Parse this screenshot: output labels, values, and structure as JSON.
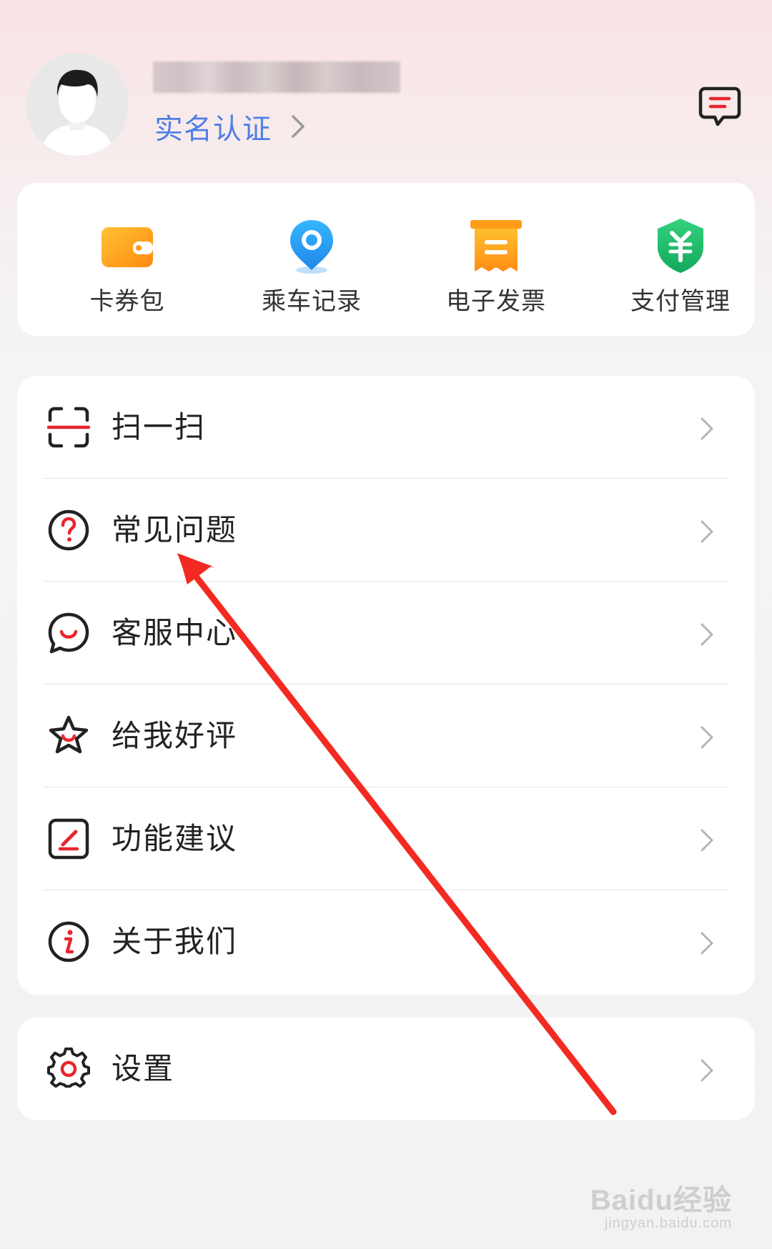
{
  "header": {
    "realname_label": "实名认证"
  },
  "quick_actions": [
    {
      "label": "卡券包",
      "icon": "wallet-icon",
      "color": "#ff9a1f"
    },
    {
      "label": "乘车记录",
      "icon": "location-pin-icon",
      "color": "#2ea0f5"
    },
    {
      "label": "电子发票",
      "icon": "invoice-icon",
      "color": "#ffa31a"
    },
    {
      "label": "支付管理",
      "icon": "yuan-shield-icon",
      "color": "#1fc26b"
    }
  ],
  "menu": [
    {
      "label": "扫一扫",
      "icon": "scan-icon"
    },
    {
      "label": "常见问题",
      "icon": "question-icon"
    },
    {
      "label": "客服中心",
      "icon": "chat-smile-icon"
    },
    {
      "label": "给我好评",
      "icon": "star-smile-icon"
    },
    {
      "label": "功能建议",
      "icon": "edit-icon"
    },
    {
      "label": "关于我们",
      "icon": "info-icon"
    }
  ],
  "settings": {
    "label": "设置",
    "icon": "gear-icon"
  },
  "colors": {
    "accent_red": "#e8262e",
    "link_blue": "#4f7fe6",
    "annotation_arrow": "#f22a22"
  },
  "watermark": {
    "line1": "Baidu经验",
    "line2": "jingyan.baidu.com"
  }
}
